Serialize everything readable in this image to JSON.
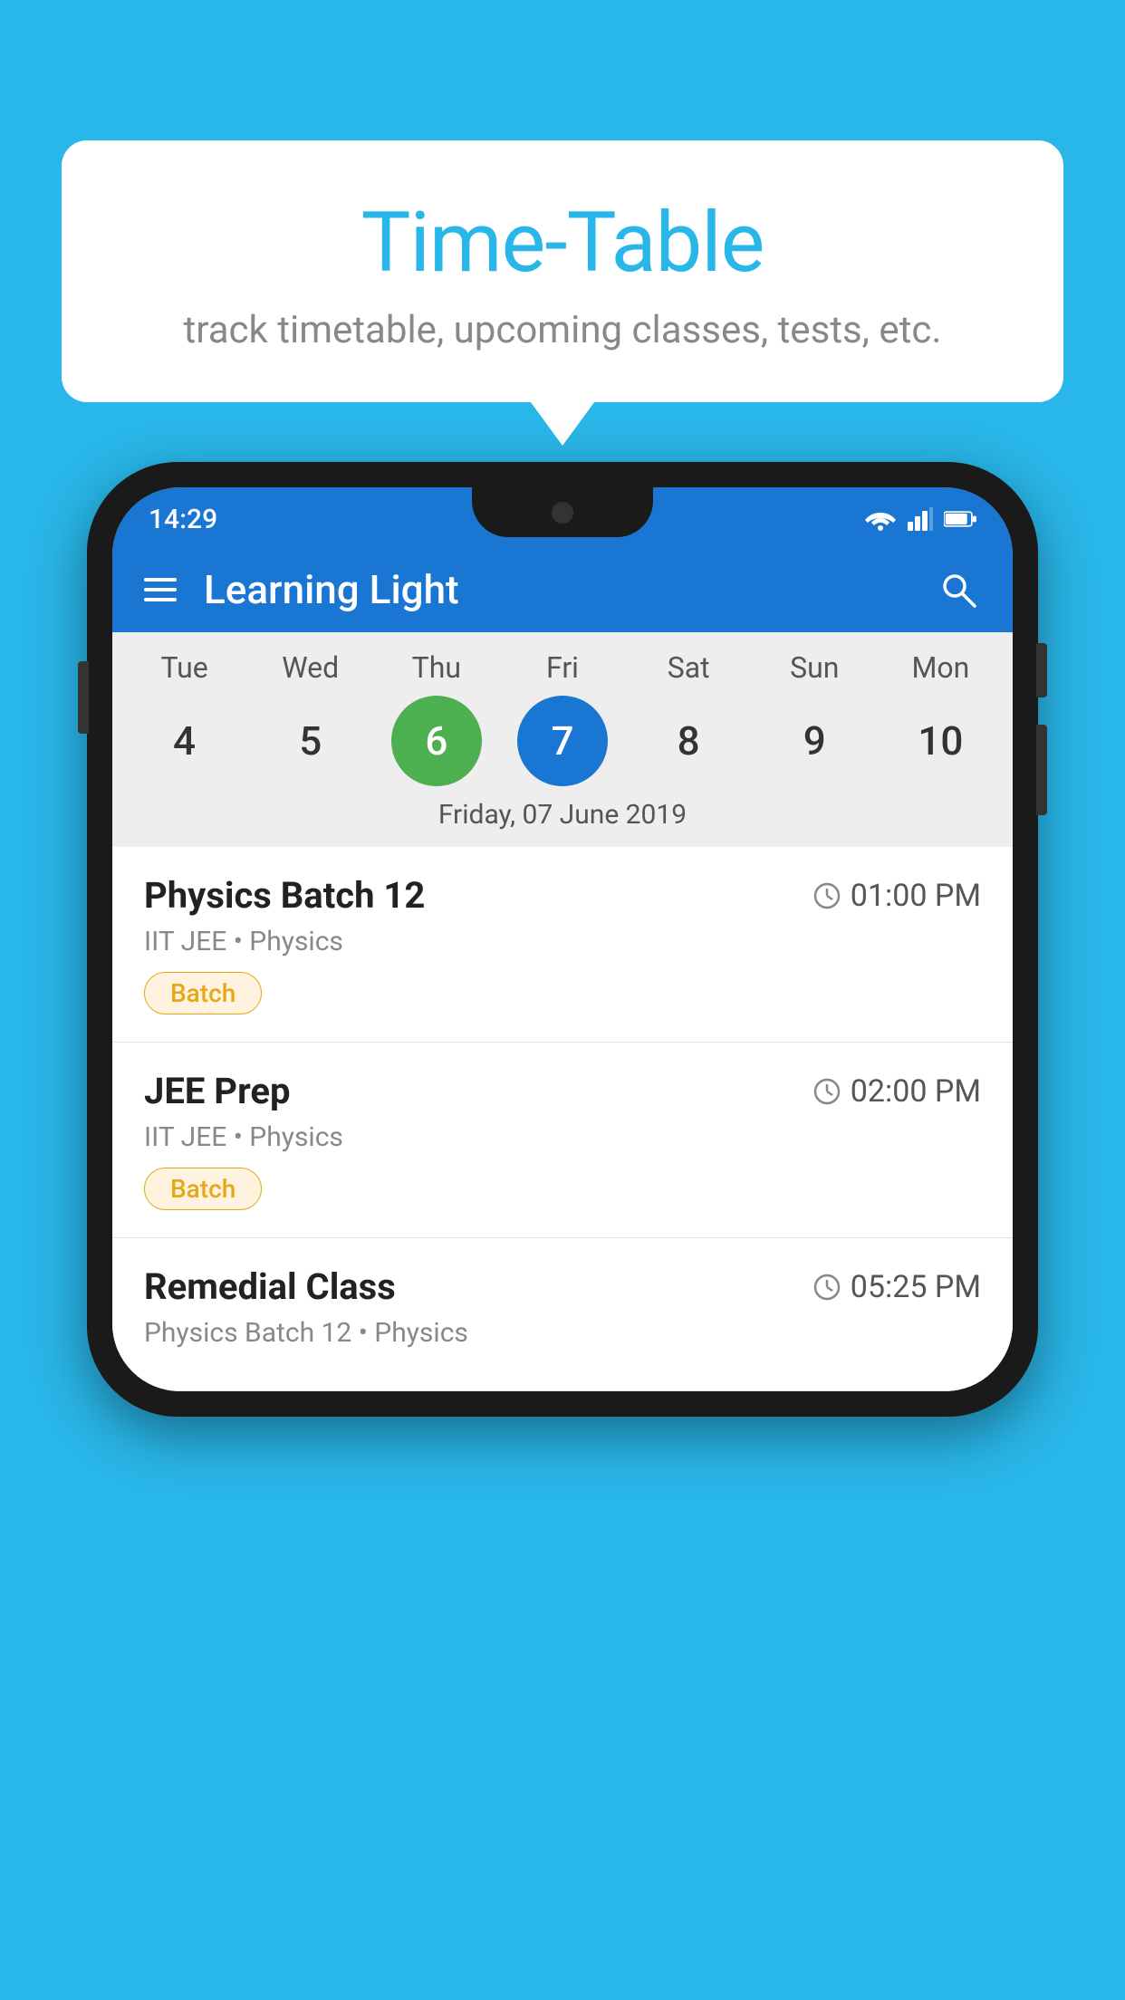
{
  "background_color": "#29b6e8",
  "bubble": {
    "title": "Time-Table",
    "subtitle": "track timetable, upcoming classes, tests, etc."
  },
  "phone": {
    "status_bar": {
      "time": "14:29"
    },
    "app_bar": {
      "title": "Learning Light"
    },
    "calendar": {
      "days": [
        {
          "label": "Tue",
          "number": "4"
        },
        {
          "label": "Wed",
          "number": "5"
        },
        {
          "label": "Thu",
          "number": "6",
          "state": "today"
        },
        {
          "label": "Fri",
          "number": "7",
          "state": "selected"
        },
        {
          "label": "Sat",
          "number": "8"
        },
        {
          "label": "Sun",
          "number": "9"
        },
        {
          "label": "Mon",
          "number": "10"
        }
      ],
      "selected_date_label": "Friday, 07 June 2019"
    },
    "classes": [
      {
        "name": "Physics Batch 12",
        "time": "01:00 PM",
        "info": "IIT JEE • Physics",
        "badge": "Batch"
      },
      {
        "name": "JEE Prep",
        "time": "02:00 PM",
        "info": "IIT JEE • Physics",
        "badge": "Batch"
      },
      {
        "name": "Remedial Class",
        "time": "05:25 PM",
        "info": "Physics Batch 12 • Physics",
        "badge": ""
      }
    ]
  }
}
